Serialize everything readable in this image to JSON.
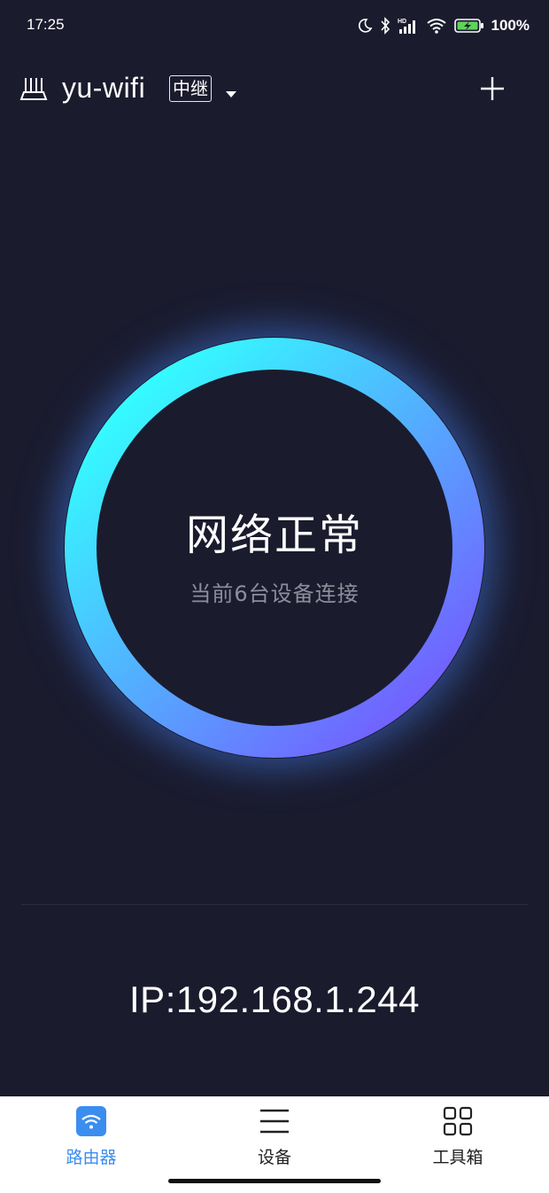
{
  "status_bar": {
    "time": "17:25",
    "battery_percent": "100%",
    "icons": [
      "moon-icon",
      "bluetooth-icon",
      "hd-signal-icon",
      "wifi-icon",
      "battery-charging-icon"
    ]
  },
  "header": {
    "network_name": "yu-wifi",
    "mode_badge": "中继",
    "icons": [
      "router-icon",
      "dropdown-icon",
      "add-icon"
    ]
  },
  "status_ring": {
    "title": "网络正常",
    "subtitle": "当前6台设备连接",
    "gradient_start": "#33ffff",
    "gradient_end": "#7559ff"
  },
  "ip_address": "IP:192.168.1.244",
  "bottom_nav": {
    "items": [
      {
        "label": "路由器",
        "icon": "wifi-square-icon",
        "active": true
      },
      {
        "label": "设备",
        "icon": "menu-lines-icon",
        "active": false
      },
      {
        "label": "工具箱",
        "icon": "grid-icon",
        "active": false
      }
    ],
    "active_color": "#3b8df0"
  }
}
